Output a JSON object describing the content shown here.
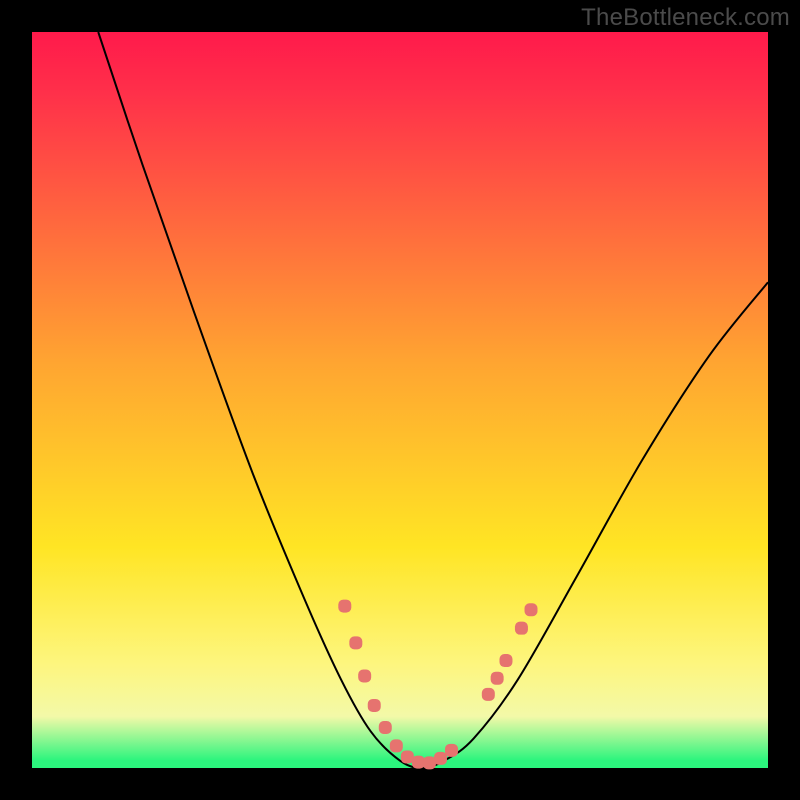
{
  "watermark": "TheBottleneck.com",
  "colors": {
    "top": "#ff1a4b",
    "red": "#ff2f4a",
    "orange": "#ffa531",
    "yellow": "#ffe524",
    "paleyellow": "#fdf67f",
    "paleyellow2": "#f3f9a8",
    "green": "#2bf57d",
    "marker": "#e6736f"
  },
  "chart_data": {
    "type": "line",
    "title": "",
    "xlabel": "",
    "ylabel": "",
    "xlim": [
      0,
      100
    ],
    "ylim": [
      0,
      100
    ],
    "grid": false,
    "legend": false,
    "note": "Axes carry no tick labels; values are read as percentage of plot width/height. y=0 is the bottom (green) edge, y=100 the top (red) edge.",
    "series": [
      {
        "name": "bottleneck-curve",
        "x": [
          9,
          15,
          22,
          30,
          37,
          42,
          46,
          50,
          53,
          56,
          60,
          66,
          74,
          83,
          92,
          100
        ],
        "y": [
          100,
          82,
          62,
          40,
          23,
          12,
          5,
          1,
          0,
          1,
          4,
          12,
          26,
          42,
          56,
          66
        ]
      }
    ],
    "markers": {
      "name": "highlight-dots",
      "shape": "rounded",
      "points": [
        {
          "x": 42.5,
          "y": 22.0
        },
        {
          "x": 44.0,
          "y": 17.0
        },
        {
          "x": 45.2,
          "y": 12.5
        },
        {
          "x": 46.5,
          "y": 8.5
        },
        {
          "x": 48.0,
          "y": 5.5
        },
        {
          "x": 49.5,
          "y": 3.0
        },
        {
          "x": 51.0,
          "y": 1.5
        },
        {
          "x": 52.5,
          "y": 0.8
        },
        {
          "x": 54.0,
          "y": 0.7
        },
        {
          "x": 55.5,
          "y": 1.3
        },
        {
          "x": 57.0,
          "y": 2.4
        },
        {
          "x": 62.0,
          "y": 10.0
        },
        {
          "x": 63.2,
          "y": 12.2
        },
        {
          "x": 64.4,
          "y": 14.6
        },
        {
          "x": 66.5,
          "y": 19.0
        },
        {
          "x": 67.8,
          "y": 21.5
        }
      ]
    }
  }
}
